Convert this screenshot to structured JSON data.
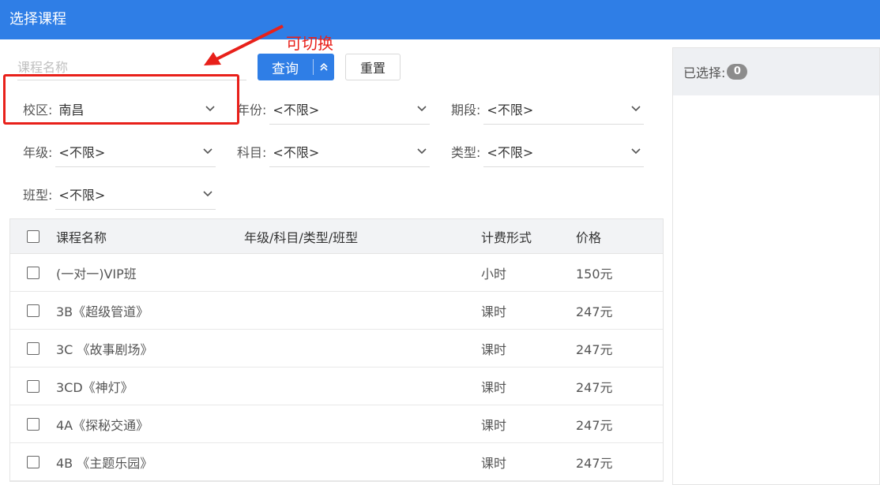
{
  "window": {
    "title": "选择课程"
  },
  "search": {
    "placeholder": "课程名称"
  },
  "buttons": {
    "query": "查询",
    "reset": "重置"
  },
  "annotation": {
    "text": "可切换"
  },
  "filters": {
    "campus": {
      "label": "校区:",
      "value": "南昌"
    },
    "year": {
      "label": "年份:",
      "value": "<不限>"
    },
    "term": {
      "label": "期段:",
      "value": "<不限>"
    },
    "grade": {
      "label": "年级:",
      "value": "<不限>"
    },
    "subject": {
      "label": "科目:",
      "value": "<不限>"
    },
    "type": {
      "label": "类型:",
      "value": "<不限>"
    },
    "class_type": {
      "label": "班型:",
      "value": "<不限>"
    }
  },
  "table": {
    "headers": {
      "name": "课程名称",
      "category": "年级/科目/类型/班型",
      "billing": "计费形式",
      "price": "价格"
    },
    "rows": [
      {
        "name": "(一对一)VIP班",
        "category": "",
        "billing": "小时",
        "price": "150元"
      },
      {
        "name": "3B《超级管道》",
        "category": "",
        "billing": "课时",
        "price": "247元"
      },
      {
        "name": "3C 《故事剧场》",
        "category": "",
        "billing": "课时",
        "price": "247元"
      },
      {
        "name": "3CD《神灯》",
        "category": "",
        "billing": "课时",
        "price": "247元"
      },
      {
        "name": "4A《探秘交通》",
        "category": "",
        "billing": "课时",
        "price": "247元"
      },
      {
        "name": "4B 《主题乐园》",
        "category": "",
        "billing": "课时",
        "price": "247元"
      }
    ]
  },
  "selected_panel": {
    "label": "已选择:",
    "count": "0"
  },
  "colors": {
    "primary": "#2f7ee6",
    "annotation": "#e8201a"
  },
  "icons": {
    "dropdown": "chevron-down-icon",
    "expand": "double-chevron-up-icon"
  }
}
